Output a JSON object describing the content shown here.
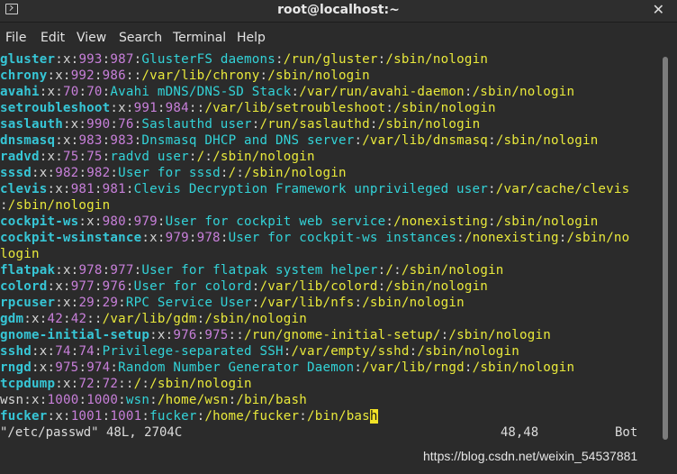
{
  "window": {
    "title": "root@localhost:~",
    "close_icon": "close-icon"
  },
  "menubar": {
    "items": [
      "File",
      "Edit",
      "View",
      "Search",
      "Terminal",
      "Help"
    ]
  },
  "terminal": {
    "lines": [
      [
        [
          "user",
          "gluster"
        ],
        [
          "sep",
          ":x:"
        ],
        [
          "num",
          "993"
        ],
        [
          "sep",
          ":"
        ],
        [
          "num",
          "987"
        ],
        [
          "sep",
          ":"
        ],
        [
          "txt",
          "GlusterFS daemons"
        ],
        [
          "sep",
          ":"
        ],
        [
          "path",
          "/run/gluster"
        ],
        [
          "sep",
          ":"
        ],
        [
          "path",
          "/sbin/nologin"
        ]
      ],
      [
        [
          "user",
          "chrony"
        ],
        [
          "sep",
          ":x:"
        ],
        [
          "num",
          "992"
        ],
        [
          "sep",
          ":"
        ],
        [
          "num",
          "986"
        ],
        [
          "sep",
          "::"
        ],
        [
          "path",
          "/var/lib/chrony"
        ],
        [
          "sep",
          ":"
        ],
        [
          "path",
          "/sbin/nologin"
        ]
      ],
      [
        [
          "user",
          "avahi"
        ],
        [
          "sep",
          ":x:"
        ],
        [
          "num",
          "70"
        ],
        [
          "sep",
          ":"
        ],
        [
          "num",
          "70"
        ],
        [
          "sep",
          ":"
        ],
        [
          "txt",
          "Avahi mDNS/DNS-SD Stack"
        ],
        [
          "sep",
          ":"
        ],
        [
          "path",
          "/var/run/avahi-daemon"
        ],
        [
          "sep",
          ":"
        ],
        [
          "path",
          "/sbin/nologin"
        ]
      ],
      [
        [
          "user",
          "setroubleshoot"
        ],
        [
          "sep",
          ":x:"
        ],
        [
          "num",
          "991"
        ],
        [
          "sep",
          ":"
        ],
        [
          "num",
          "984"
        ],
        [
          "sep",
          "::"
        ],
        [
          "path",
          "/var/lib/setroubleshoot"
        ],
        [
          "sep",
          ":"
        ],
        [
          "path",
          "/sbin/nologin"
        ]
      ],
      [
        [
          "user",
          "saslauth"
        ],
        [
          "sep",
          ":x:"
        ],
        [
          "num",
          "990"
        ],
        [
          "sep",
          ":"
        ],
        [
          "num",
          "76"
        ],
        [
          "sep",
          ":"
        ],
        [
          "txt",
          "Saslauthd user"
        ],
        [
          "sep",
          ":"
        ],
        [
          "path",
          "/run/saslauthd"
        ],
        [
          "sep",
          ":"
        ],
        [
          "path",
          "/sbin/nologin"
        ]
      ],
      [
        [
          "user",
          "dnsmasq"
        ],
        [
          "sep",
          ":x:"
        ],
        [
          "num",
          "983"
        ],
        [
          "sep",
          ":"
        ],
        [
          "num",
          "983"
        ],
        [
          "sep",
          ":"
        ],
        [
          "txt",
          "Dnsmasq DHCP and DNS server"
        ],
        [
          "sep",
          ":"
        ],
        [
          "path",
          "/var/lib/dnsmasq"
        ],
        [
          "sep",
          ":"
        ],
        [
          "path",
          "/sbin/nologin"
        ]
      ],
      [
        [
          "user",
          "radvd"
        ],
        [
          "sep",
          ":x:"
        ],
        [
          "num",
          "75"
        ],
        [
          "sep",
          ":"
        ],
        [
          "num",
          "75"
        ],
        [
          "sep",
          ":"
        ],
        [
          "txt",
          "radvd user"
        ],
        [
          "sep",
          ":"
        ],
        [
          "path",
          "/"
        ],
        [
          "sep",
          ":"
        ],
        [
          "path",
          "/sbin/nologin"
        ]
      ],
      [
        [
          "user",
          "sssd"
        ],
        [
          "sep",
          ":x:"
        ],
        [
          "num",
          "982"
        ],
        [
          "sep",
          ":"
        ],
        [
          "num",
          "982"
        ],
        [
          "sep",
          ":"
        ],
        [
          "txt",
          "User for sssd"
        ],
        [
          "sep",
          ":"
        ],
        [
          "path",
          "/"
        ],
        [
          "sep",
          ":"
        ],
        [
          "path",
          "/sbin/nologin"
        ]
      ],
      [
        [
          "user",
          "clevis"
        ],
        [
          "sep",
          ":x:"
        ],
        [
          "num",
          "981"
        ],
        [
          "sep",
          ":"
        ],
        [
          "num",
          "981"
        ],
        [
          "sep",
          ":"
        ],
        [
          "txt",
          "Clevis Decryption Framework unprivileged user"
        ],
        [
          "sep",
          ":"
        ],
        [
          "path",
          "/var/cache/clevis"
        ]
      ],
      [
        [
          "sep",
          ":"
        ],
        [
          "path",
          "/sbin/nologin"
        ]
      ],
      [
        [
          "user",
          "cockpit-ws"
        ],
        [
          "sep",
          ":x:"
        ],
        [
          "num",
          "980"
        ],
        [
          "sep",
          ":"
        ],
        [
          "num",
          "979"
        ],
        [
          "sep",
          ":"
        ],
        [
          "txt",
          "User for cockpit web service"
        ],
        [
          "sep",
          ":"
        ],
        [
          "path",
          "/nonexisting"
        ],
        [
          "sep",
          ":"
        ],
        [
          "path",
          "/sbin/nologin"
        ]
      ],
      [
        [
          "user",
          "cockpit-wsinstance"
        ],
        [
          "sep",
          ":x:"
        ],
        [
          "num",
          "979"
        ],
        [
          "sep",
          ":"
        ],
        [
          "num",
          "978"
        ],
        [
          "sep",
          ":"
        ],
        [
          "txt",
          "User for cockpit-ws instances"
        ],
        [
          "sep",
          ":"
        ],
        [
          "path",
          "/nonexisting"
        ],
        [
          "sep",
          ":"
        ],
        [
          "path",
          "/sbin/no"
        ]
      ],
      [
        [
          "path",
          "login"
        ]
      ],
      [
        [
          "user",
          "flatpak"
        ],
        [
          "sep",
          ":x:"
        ],
        [
          "num",
          "978"
        ],
        [
          "sep",
          ":"
        ],
        [
          "num",
          "977"
        ],
        [
          "sep",
          ":"
        ],
        [
          "txt",
          "User for flatpak system helper"
        ],
        [
          "sep",
          ":"
        ],
        [
          "path",
          "/"
        ],
        [
          "sep",
          ":"
        ],
        [
          "path",
          "/sbin/nologin"
        ]
      ],
      [
        [
          "user",
          "colord"
        ],
        [
          "sep",
          ":x:"
        ],
        [
          "num",
          "977"
        ],
        [
          "sep",
          ":"
        ],
        [
          "num",
          "976"
        ],
        [
          "sep",
          ":"
        ],
        [
          "txt",
          "User for colord"
        ],
        [
          "sep",
          ":"
        ],
        [
          "path",
          "/var/lib/colord"
        ],
        [
          "sep",
          ":"
        ],
        [
          "path",
          "/sbin/nologin"
        ]
      ],
      [
        [
          "user",
          "rpcuser"
        ],
        [
          "sep",
          ":x:"
        ],
        [
          "num",
          "29"
        ],
        [
          "sep",
          ":"
        ],
        [
          "num",
          "29"
        ],
        [
          "sep",
          ":"
        ],
        [
          "txt",
          "RPC Service User"
        ],
        [
          "sep",
          ":"
        ],
        [
          "path",
          "/var/lib/nfs"
        ],
        [
          "sep",
          ":"
        ],
        [
          "path",
          "/sbin/nologin"
        ]
      ],
      [
        [
          "user",
          "gdm"
        ],
        [
          "sep",
          ":x:"
        ],
        [
          "num",
          "42"
        ],
        [
          "sep",
          ":"
        ],
        [
          "num",
          "42"
        ],
        [
          "sep",
          "::"
        ],
        [
          "path",
          "/var/lib/gdm"
        ],
        [
          "sep",
          ":"
        ],
        [
          "path",
          "/sbin/nologin"
        ]
      ],
      [
        [
          "user",
          "gnome-initial-setup"
        ],
        [
          "sep",
          ":x:"
        ],
        [
          "num",
          "976"
        ],
        [
          "sep",
          ":"
        ],
        [
          "num",
          "975"
        ],
        [
          "sep",
          "::"
        ],
        [
          "path",
          "/run/gnome-initial-setup/"
        ],
        [
          "sep",
          ":"
        ],
        [
          "path",
          "/sbin/nologin"
        ]
      ],
      [
        [
          "user",
          "sshd"
        ],
        [
          "sep",
          ":x:"
        ],
        [
          "num",
          "74"
        ],
        [
          "sep",
          ":"
        ],
        [
          "num",
          "74"
        ],
        [
          "sep",
          ":"
        ],
        [
          "txt",
          "Privilege-separated SSH"
        ],
        [
          "sep",
          ":"
        ],
        [
          "path",
          "/var/empty/sshd"
        ],
        [
          "sep",
          ":"
        ],
        [
          "path",
          "/sbin/nologin"
        ]
      ],
      [
        [
          "user",
          "rngd"
        ],
        [
          "sep",
          ":x:"
        ],
        [
          "num",
          "975"
        ],
        [
          "sep",
          ":"
        ],
        [
          "num",
          "974"
        ],
        [
          "sep",
          ":"
        ],
        [
          "txt",
          "Random Number Generator Daemon"
        ],
        [
          "sep",
          ":"
        ],
        [
          "path",
          "/var/lib/rngd"
        ],
        [
          "sep",
          ":"
        ],
        [
          "path",
          "/sbin/nologin"
        ]
      ],
      [
        [
          "user",
          "tcpdump"
        ],
        [
          "sep",
          ":x:"
        ],
        [
          "num",
          "72"
        ],
        [
          "sep",
          ":"
        ],
        [
          "num",
          "72"
        ],
        [
          "sep",
          "::"
        ],
        [
          "path",
          "/"
        ],
        [
          "sep",
          ":"
        ],
        [
          "path",
          "/sbin/nologin"
        ]
      ],
      [
        [
          "plain",
          "wsn"
        ],
        [
          "sep",
          ":x:"
        ],
        [
          "num",
          "1000"
        ],
        [
          "sep",
          ":"
        ],
        [
          "num",
          "1000"
        ],
        [
          "sep",
          ":"
        ],
        [
          "txt",
          "wsn"
        ],
        [
          "sep",
          ":"
        ],
        [
          "path",
          "/home/wsn"
        ],
        [
          "sep",
          ":"
        ],
        [
          "path",
          "/bin/bash"
        ]
      ],
      [
        [
          "user",
          "fucker"
        ],
        [
          "sep",
          ":x:"
        ],
        [
          "num",
          "1001"
        ],
        [
          "sep",
          ":"
        ],
        [
          "num",
          "1001"
        ],
        [
          "sep",
          ":"
        ],
        [
          "txt",
          "fucker"
        ],
        [
          "sep",
          ":"
        ],
        [
          "path",
          "/home/fucker"
        ],
        [
          "sep",
          ":"
        ],
        [
          "path",
          "/bin/bas"
        ],
        [
          "cursor",
          "h"
        ]
      ]
    ],
    "status_file": "\"/etc/passwd\" 48L, 2704C",
    "status_pos": "48,48",
    "status_scroll": "Bot"
  },
  "watermark": "https://blog.csdn.net/weixin_54537881"
}
